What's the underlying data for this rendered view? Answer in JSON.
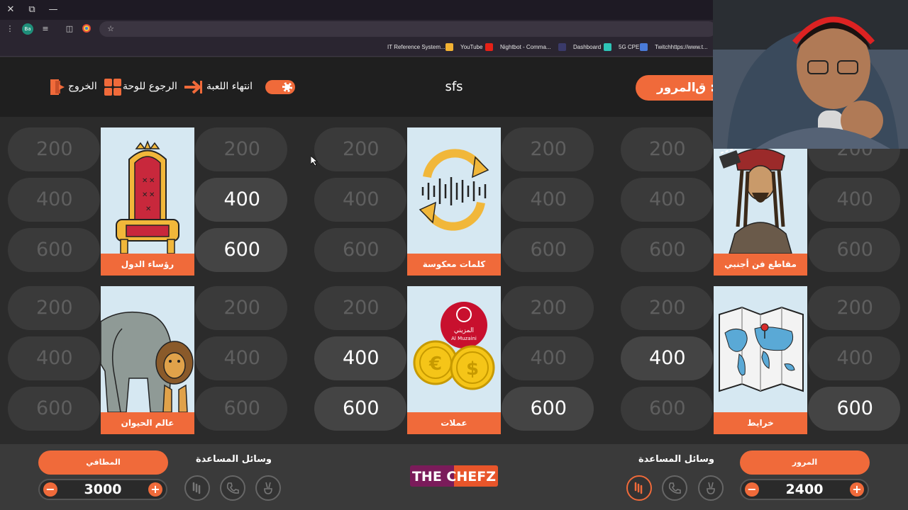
{
  "browser": {
    "window_controls": [
      "✕",
      "⧉",
      "—"
    ],
    "profile_initials": "Ba",
    "bookmarks": [
      {
        "label": "IT Reference System...",
        "color": "#f2b233"
      },
      {
        "label": "YouTube",
        "color": "#e62117"
      },
      {
        "label": "Nightbot - Comma...",
        "color": "#3a3a6a"
      },
      {
        "label": "Dashboard",
        "color": "#2ec4b6"
      },
      {
        "label": "5G CPE",
        "color": "#4a7bd8"
      },
      {
        "label": "Twitchhttps://www.t...",
        "color": "#9146ff"
      }
    ]
  },
  "header": {
    "exit_label": "الخروج",
    "back_label": "الرجوع للوحة",
    "end_game_label": "انتهاء اللعبة",
    "game_title": "sfs",
    "turn_prefix": "ق :",
    "turn_team": "المرور"
  },
  "colors": {
    "accent": "#f06a3a",
    "pill": "#3a3a3a",
    "background": "#2b2b2b"
  },
  "board": {
    "categories": [
      {
        "name": "رؤساء الدول",
        "icon": "throne-icon"
      },
      {
        "name": "كلمات معكوسة",
        "icon": "reverse-audio-icon"
      },
      {
        "name": "مقاطع فن أجنبي",
        "icon": "pirate-icon"
      },
      {
        "name": "عالم الحيوان",
        "icon": "elephant-lion-icon"
      },
      {
        "name": "عملات",
        "icon": "coins-icon",
        "brand_line1": "المزيني",
        "brand_line2": "Al Muzaini"
      },
      {
        "name": "خرايط",
        "icon": "world-map-icon"
      }
    ],
    "pills": [
      [
        "200",
        "200",
        "400",
        "400",
        "600",
        "600"
      ],
      [
        "200",
        "200",
        "400",
        "400",
        "600",
        "600"
      ],
      [
        "200",
        "200",
        "400",
        "400",
        "600",
        "600"
      ],
      [
        "200",
        "200",
        "400",
        "400",
        "600",
        "600"
      ],
      [
        "200",
        "200",
        "400",
        "400",
        "600",
        "600"
      ],
      [
        "200",
        "200",
        "400",
        "400",
        "600",
        "600"
      ]
    ]
  },
  "bottom": {
    "left_team": {
      "name": "المطافي",
      "score": "3000",
      "aids_title": "وسائل المساعدة"
    },
    "right_team": {
      "name": "المرور",
      "score": "2400",
      "aids_title": "وسائل المساعدة"
    },
    "minus": "−",
    "plus": "+",
    "logo_text": "THE CHEFZ"
  }
}
